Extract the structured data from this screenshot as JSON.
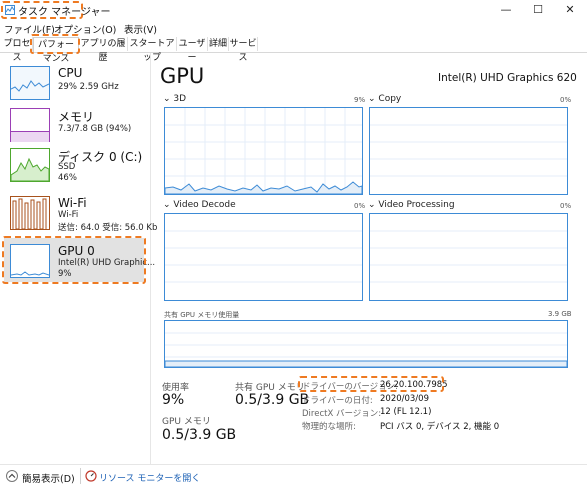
{
  "window": {
    "title": "タスク マネージャー",
    "minimize": "—",
    "maximize": "☐",
    "close": "✕"
  },
  "menu": [
    "ファイル(F)",
    "オプション(O)",
    "表示(V)"
  ],
  "tabs": [
    "プロセス",
    "パフォーマンス",
    "アプリの履歴",
    "スタートアップ",
    "ユーザー",
    "詳細",
    "サービス"
  ],
  "active_tab": "パフォーマンス",
  "sidebar": [
    {
      "name": "CPU",
      "line1": "29%  2.59 GHz",
      "line2": "",
      "line3": "",
      "color": "#3d8bd6"
    },
    {
      "name": "メモリ",
      "line1": "7.3/7.8 GB (94%)",
      "line2": "",
      "line3": "",
      "color": "#9b3fb5"
    },
    {
      "name": "ディスク 0 (C:)",
      "line1": "SSD",
      "line2": "46%",
      "line3": "",
      "color": "#4ea72e"
    },
    {
      "name": "Wi-Fi",
      "line1": "Wi-Fi",
      "line2": "送信: 64.0  受信: 56.0 Kb",
      "line3": "",
      "color": "#a8521c"
    },
    {
      "name": "GPU 0",
      "line1": "Intel(R) UHD Graphic...",
      "line2": "9%",
      "line3": "",
      "color": "#3d8bd6"
    }
  ],
  "main": {
    "title": "GPU",
    "model": "Intel(R) UHD Graphics 620",
    "engines": [
      {
        "label": "3D",
        "pct": "9%"
      },
      {
        "label": "Copy",
        "pct": "0%"
      },
      {
        "label": "Video Decode",
        "pct": "0%"
      },
      {
        "label": "Video Processing",
        "pct": "0%"
      }
    ],
    "shared_mem_label": "共有 GPU メモリ使用量",
    "shared_mem_max": "3.9 GB"
  },
  "stats": {
    "usage_label": "使用率",
    "usage_value": "9%",
    "shared_label": "共有 GPU メモリ",
    "shared_value": "0.5/3.9 GB",
    "gpu_mem_label": "GPU メモリ",
    "gpu_mem_value": "0.5/3.9 GB"
  },
  "info": {
    "driver_version_label": "ドライバーのバージョン:",
    "driver_version": "26.20.100.7985",
    "driver_date_label": "ドライバーの日付:",
    "driver_date": "2020/03/09",
    "directx_label": "DirectX バージョン:",
    "directx": "12 (FL 12.1)",
    "location_label": "物理的な場所:",
    "location": "PCI バス 0, デバイス 2, 機能 0"
  },
  "footer": {
    "fewer_details": "簡易表示(D)",
    "resource_monitor": "リソース モニターを開く"
  },
  "colors": {
    "accent": "#3d8bd6",
    "highlight": "#ee7a22"
  }
}
